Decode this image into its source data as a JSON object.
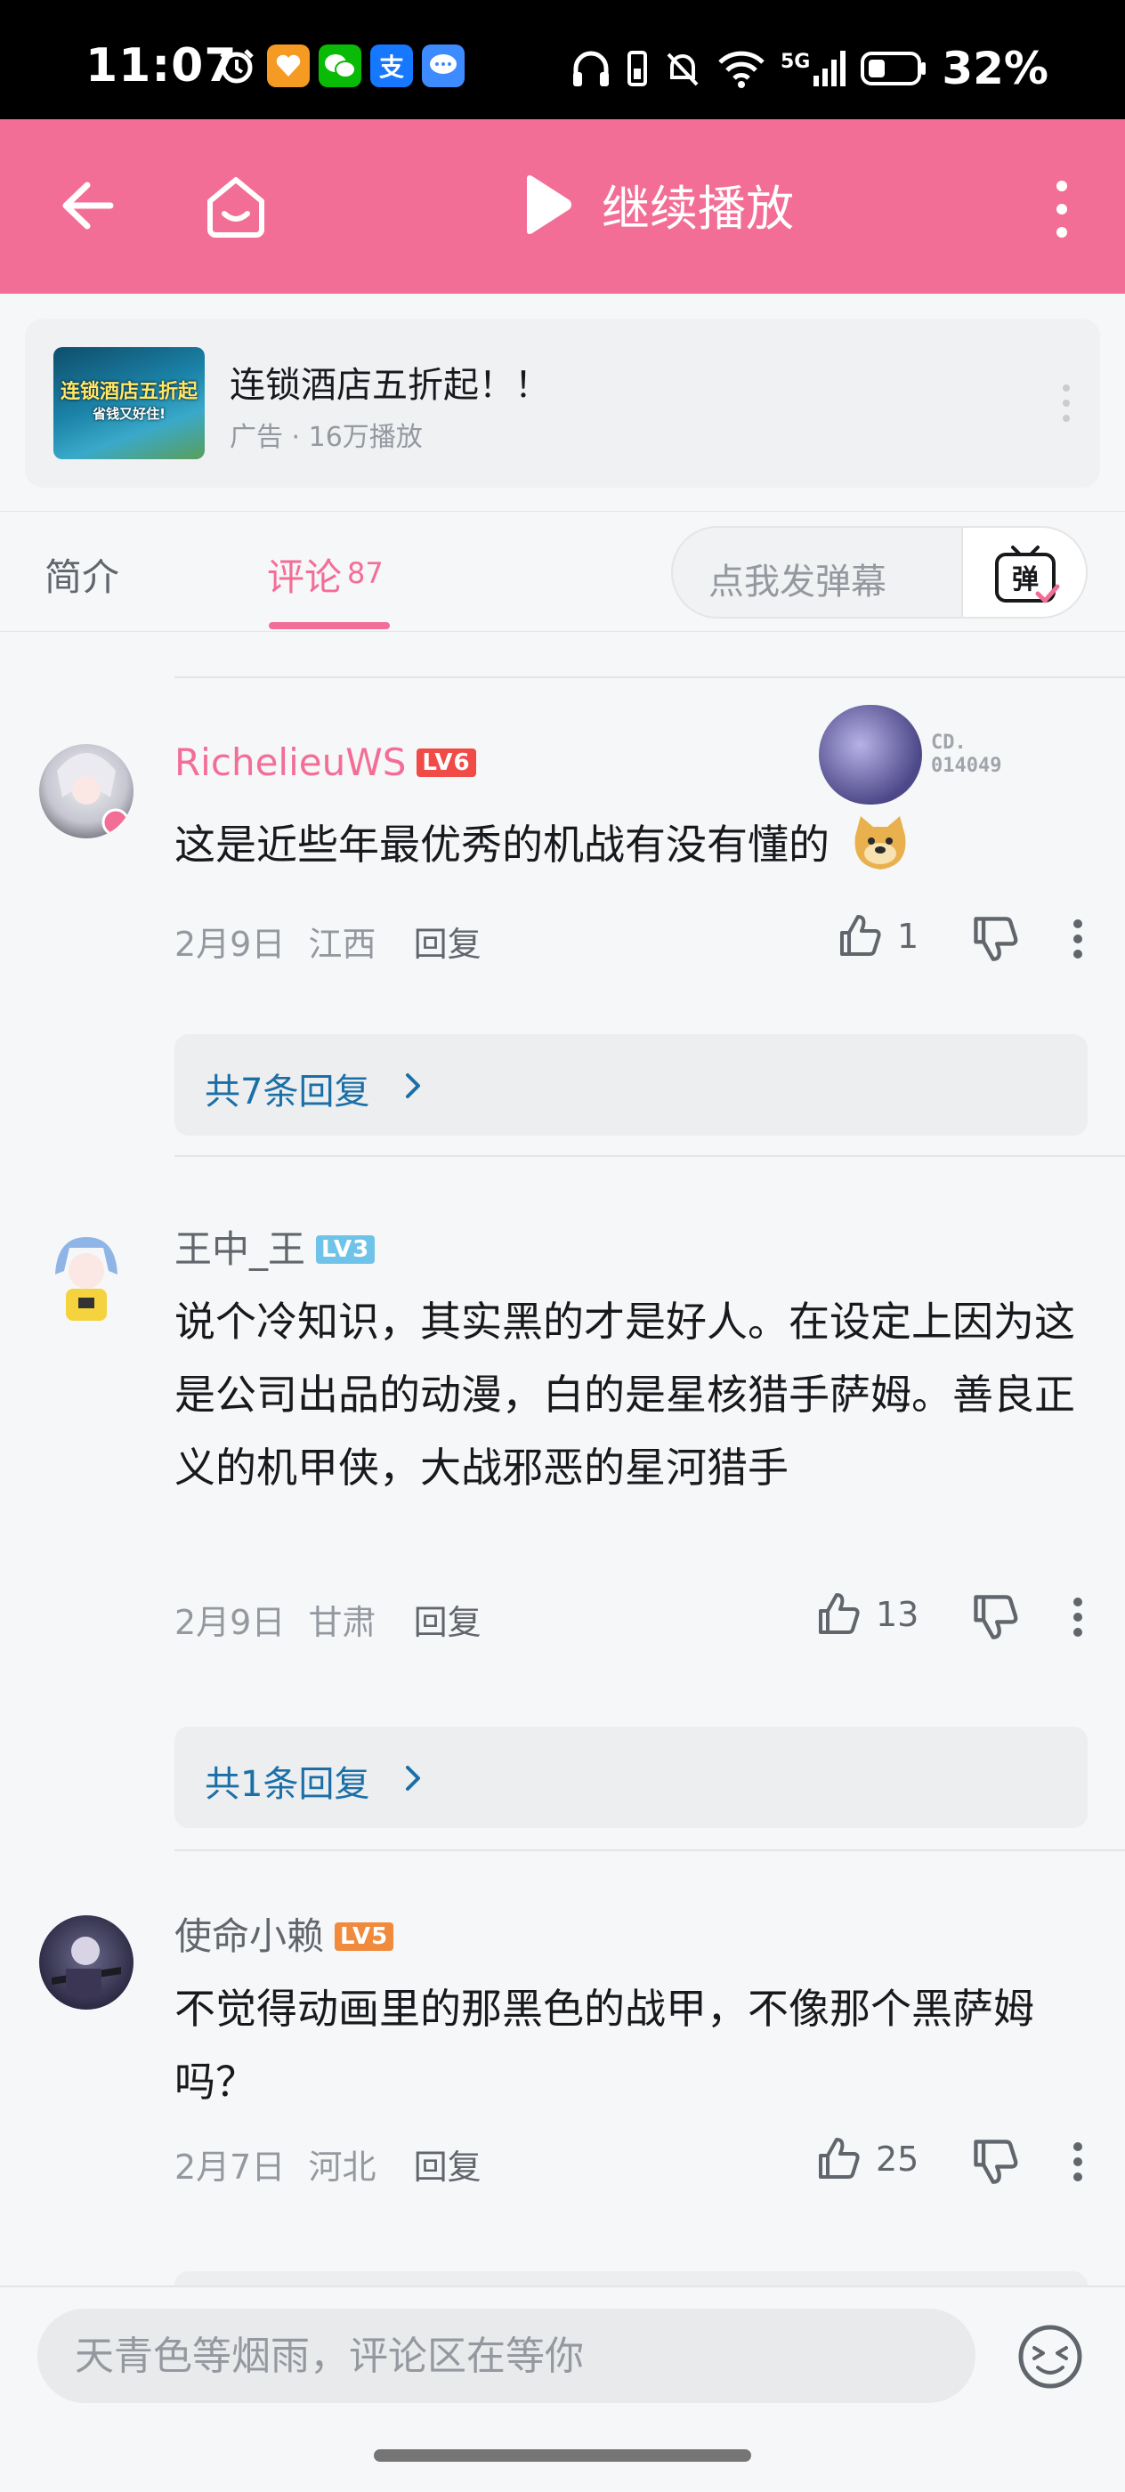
{
  "status_bar": {
    "time": "11:07",
    "network": "5G",
    "battery": "32%",
    "apps": [
      {
        "icon": "alarm-icon",
        "color": "#000000"
      },
      {
        "icon": "heart-app-icon",
        "color": "#f59a23"
      },
      {
        "icon": "wechat-icon",
        "color": "#09bb07"
      },
      {
        "icon": "alipay-icon",
        "color": "#1677ff",
        "glyph": "支"
      },
      {
        "icon": "message-icon",
        "color": "#3d8bff"
      }
    ]
  },
  "header": {
    "title": "继续播放",
    "accent": "#f36e96"
  },
  "ad": {
    "title": "连锁酒店五折起！！",
    "subtitle": "广告 · 16万播放",
    "thumb_line1": "连锁酒店五折起",
    "thumb_line2": "省钱又好住!"
  },
  "tabs": {
    "intro": "简介",
    "comments": "评论",
    "comments_count": "87",
    "danmaku_placeholder": "点我发弹幕",
    "danmaku_btn": "弹"
  },
  "comments": [
    {
      "username": "RichelieuWS",
      "username_color": "#f36e96",
      "level": "LV6",
      "level_color": "#f04b47",
      "fan_badge_no_line1": "CD.",
      "fan_badge_no_line2": "014049",
      "text": "这是近些年最优秀的机战有没有懂的",
      "date": "2月9日",
      "location": "江西",
      "reply_label": "回复",
      "likes": "1",
      "reply_summary": "共7条回复"
    },
    {
      "username": "王中_王",
      "username_color": "#61666d",
      "level": "LV3",
      "level_color": "#6fc3e9",
      "text": "说个冷知识，其实黑的才是好人。在设定上因为这是公司出品的动漫，白的是星核猎手萨姆。善良正义的机甲侠，大战邪恶的星河猎手",
      "date": "2月9日",
      "location": "甘肃",
      "reply_label": "回复",
      "likes": "13",
      "reply_summary": "共1条回复"
    },
    {
      "username": "使命小赖",
      "username_color": "#61666d",
      "level": "LV5",
      "level_color": "#f08a3c",
      "text": "不觉得动画里的那黑色的战甲，不像那个黑萨姆吗？",
      "date": "2月7日",
      "location": "河北",
      "reply_label": "回复",
      "likes": "25"
    }
  ],
  "bottom": {
    "input_placeholder": "天青色等烟雨，评论区在等你"
  }
}
